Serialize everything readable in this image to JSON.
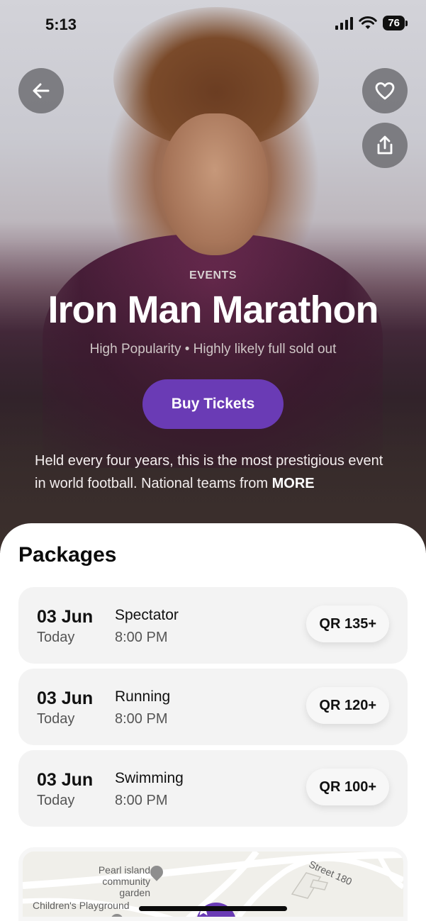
{
  "status_bar": {
    "time": "5:13",
    "battery": "76"
  },
  "hero": {
    "eyebrow": "EVENTS",
    "title": "Iron Man Marathon",
    "subtitle": "High Popularity • Highly likely full sold out",
    "buy_label": "Buy Tickets",
    "description": "Held every four years, this is the most prestigious event in world football. National teams from",
    "more_label": "MORE",
    "icons": {
      "back": "arrow-left-icon",
      "like": "heart-icon",
      "share": "share-icon"
    }
  },
  "packages": {
    "title": "Packages",
    "items": [
      {
        "date": "03 Jun",
        "day": "Today",
        "name": "Spectator",
        "time": "8:00 PM",
        "price": "QR 135+"
      },
      {
        "date": "03 Jun",
        "day": "Today",
        "name": "Running",
        "time": "8:00 PM",
        "price": "QR 120+"
      },
      {
        "date": "03 Jun",
        "day": "Today",
        "name": "Swimming",
        "time": "8:00 PM",
        "price": "QR 100+"
      }
    ]
  },
  "map": {
    "labels": {
      "garden": "Pearl island community garden",
      "playground": "Children's Playground",
      "street": "Street 180"
    }
  },
  "colors": {
    "accent": "#6a3bb5",
    "card": "#f3f3f3"
  }
}
